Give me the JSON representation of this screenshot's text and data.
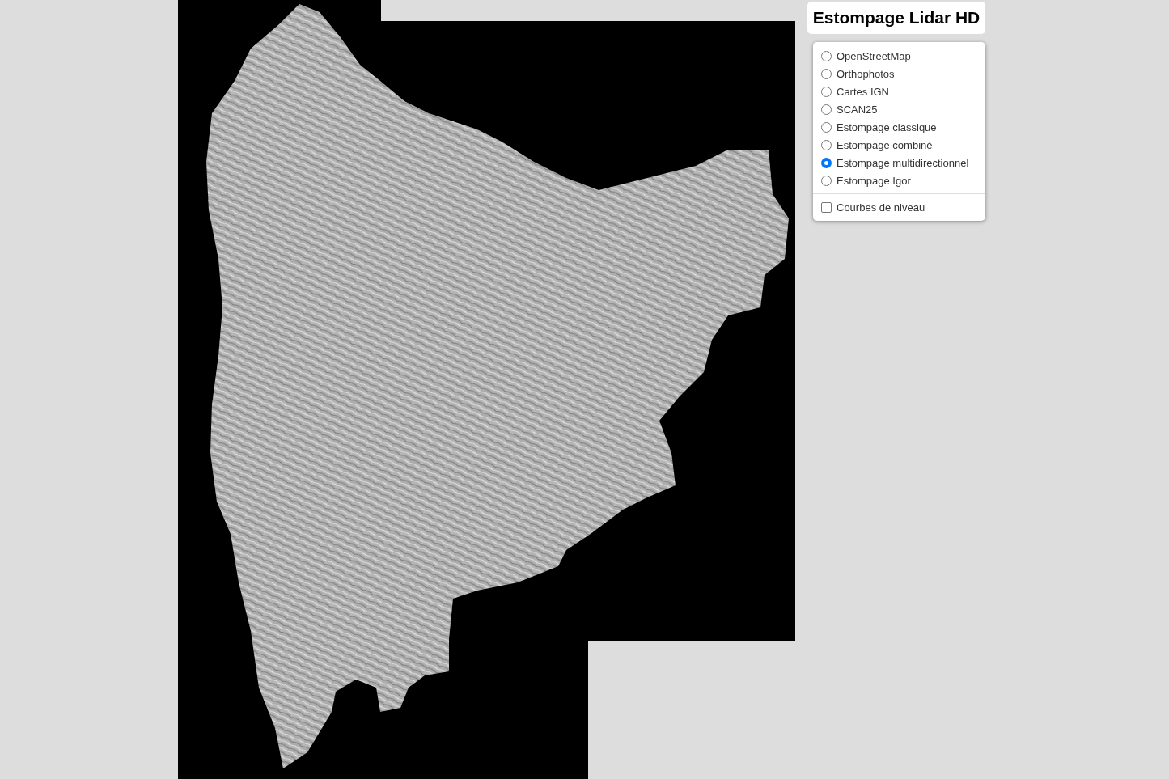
{
  "title": "Estompage Lidar HD",
  "base_layers": [
    {
      "label": "OpenStreetMap",
      "selected": false
    },
    {
      "label": "Orthophotos",
      "selected": false
    },
    {
      "label": "Cartes IGN",
      "selected": false
    },
    {
      "label": "SCAN25",
      "selected": false
    },
    {
      "label": "Estompage classique",
      "selected": false
    },
    {
      "label": "Estompage combiné",
      "selected": false
    },
    {
      "label": "Estompage multidirectionnel",
      "selected": true
    },
    {
      "label": "Estompage Igor",
      "selected": false
    }
  ],
  "overlays": [
    {
      "label": "Courbes de niveau",
      "checked": false
    }
  ]
}
